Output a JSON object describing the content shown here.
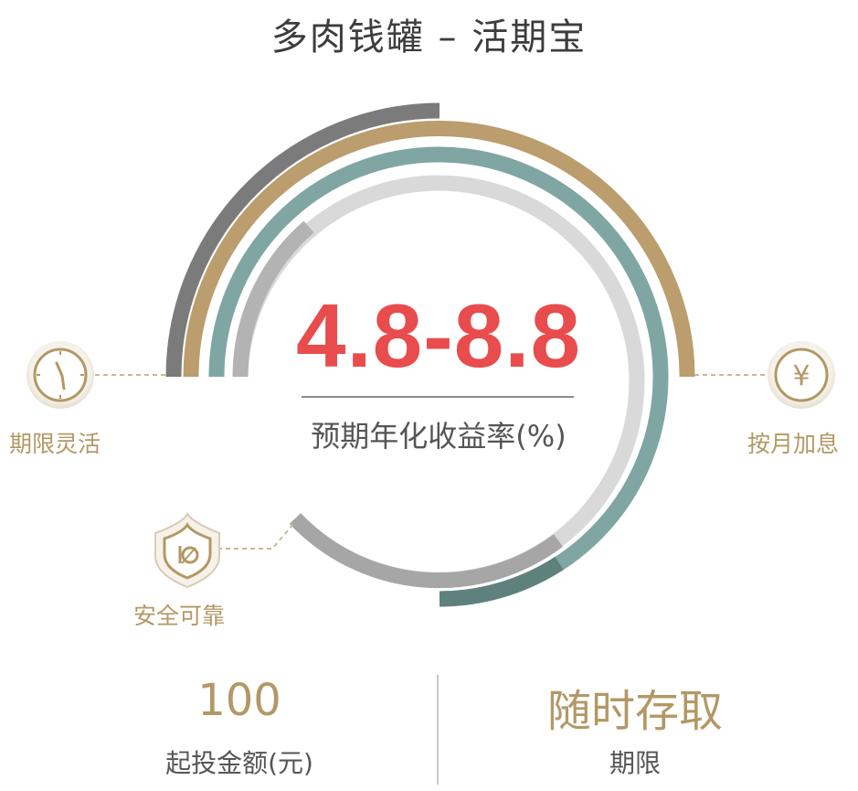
{
  "header": {
    "title": "多肉钱罐 – 活期宝"
  },
  "dial": {
    "rate": "4.8-8.8",
    "rate_label": "预期年化收益率(%)"
  },
  "features": {
    "flexible": {
      "label": "期限灵活",
      "icon": "clock-icon"
    },
    "monthly_interest": {
      "label": "按月加息",
      "icon": "yen-coin-icon"
    },
    "safe": {
      "label": "安全可靠",
      "icon": "shield-icon"
    }
  },
  "stats": {
    "min_invest": {
      "value": "100",
      "label": "起投金额(元)"
    },
    "term": {
      "value": "随时存取",
      "label": "期限"
    }
  },
  "colors": {
    "accent_gold": "#b39865",
    "rate_red": "#e94c4d",
    "ring_dark_gray": "#7b7b7b",
    "ring_gold": "#bb9d6e",
    "ring_teal": "#80a6a3",
    "ring_light_gray": "#d8d8d8"
  }
}
